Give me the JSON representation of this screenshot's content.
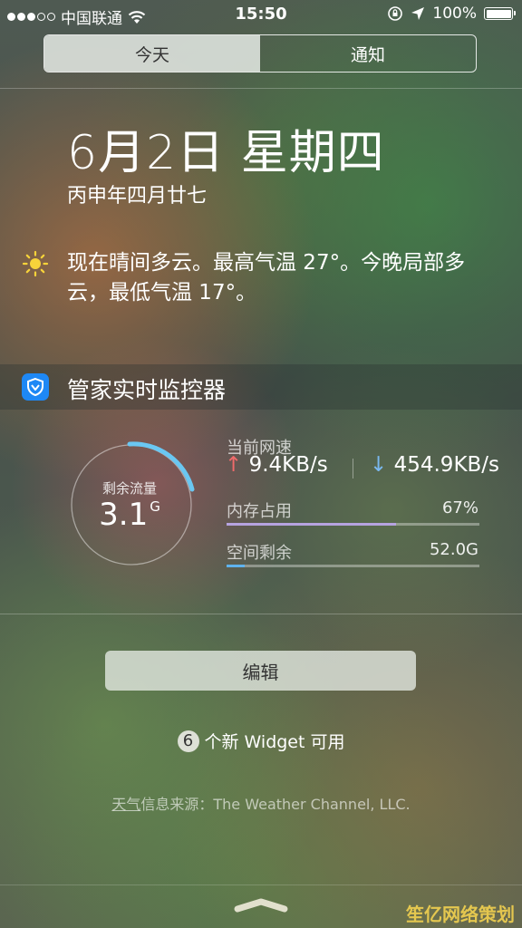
{
  "status_bar": {
    "carrier": "中国联通",
    "time": "15:50",
    "battery": "100%"
  },
  "tabs": [
    {
      "label": "今天",
      "active": true
    },
    {
      "label": "通知",
      "active": false
    }
  ],
  "today": {
    "date": "6月2日 星期四",
    "lunar": "丙申年四月廿七",
    "weather_text": "现在晴间多云。最高气温 27°。今晚局部多云，最低气温 17°。"
  },
  "widget": {
    "title": "管家实时监控器",
    "gauge_label": "剩余流量",
    "gauge_value": "3.1",
    "gauge_unit": "G",
    "net_label": "当前网速",
    "upload_arrow": "↑",
    "upload": "9.4KB/s",
    "download_arrow": "↓",
    "download": "454.9KB/s",
    "memory_label": "内存占用",
    "memory_value": "67%",
    "memory_fraction": 0.67,
    "storage_label": "空间剩余",
    "storage_value": "52.0G",
    "storage_fraction": 0.07
  },
  "edit_button": "编辑",
  "new_widgets": {
    "count": "6",
    "text": "个新 Widget 可用"
  },
  "source": {
    "link": "天气",
    "rest": "信息来源：The Weather Channel, LLC."
  },
  "watermark": "笙亿网络策划",
  "colors": {
    "memory_bar": "#b6a3e0",
    "storage_bar": "#5fb2ee",
    "gauge_arc": "#6ac7f2",
    "app_icon": "#1e88f5"
  }
}
